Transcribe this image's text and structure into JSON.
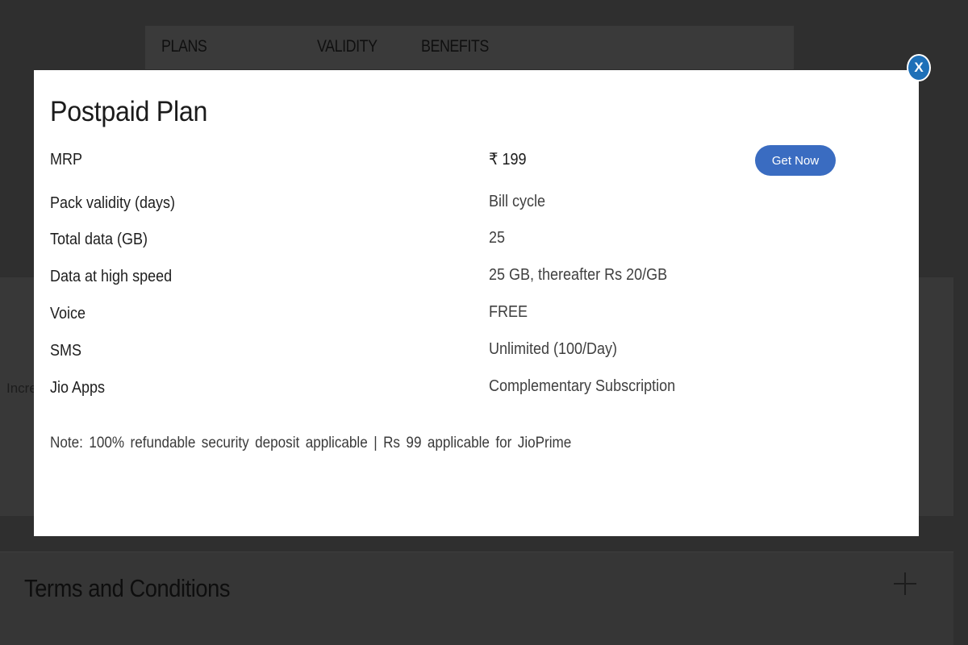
{
  "background": {
    "columns": [
      "PLANS",
      "VALIDITY",
      "BENEFITS"
    ],
    "card_text": "Incre",
    "terms_title": "Terms and Conditions"
  },
  "modal": {
    "title": "Postpaid Plan",
    "close_label": "X",
    "get_now_label": "Get Now",
    "rows": [
      {
        "label": "MRP",
        "value": "₹ 199"
      },
      {
        "label": "Pack validity (days)",
        "value": "Bill cycle"
      },
      {
        "label": "Total data (GB)",
        "value": "25"
      },
      {
        "label": "Data at high speed",
        "value": "25 GB, thereafter Rs 20/GB"
      },
      {
        "label": "Voice",
        "value": "FREE"
      },
      {
        "label": "SMS",
        "value": "Unlimited (100/Day)"
      },
      {
        "label": "Jio Apps",
        "value": "Complementary Subscription"
      }
    ],
    "note": "Note: 100% refundable security deposit applicable | Rs 99 applicable for JioPrime"
  },
  "colors": {
    "overlay": "#2f2f2f",
    "button": "#3a6cc1",
    "close": "#1e70b8"
  },
  "icons": {
    "expand": "plus-icon"
  }
}
